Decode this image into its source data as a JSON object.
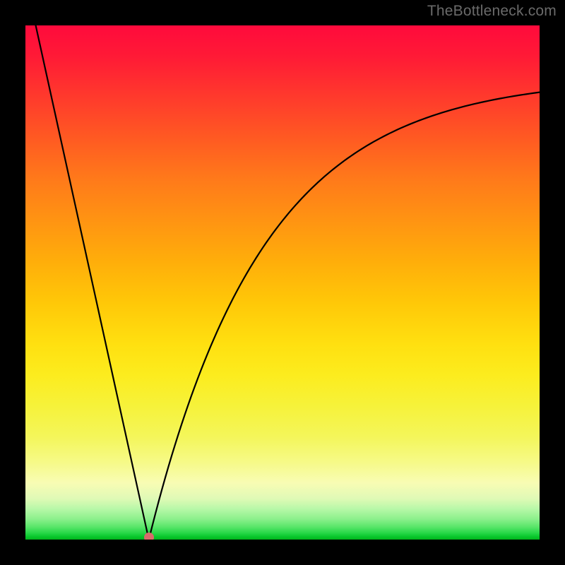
{
  "watermark": "TheBottleneck.com",
  "chart_data": {
    "type": "line",
    "title": "",
    "xlabel": "",
    "ylabel": "",
    "xlim": [
      0,
      100
    ],
    "ylim": [
      0,
      100
    ],
    "curve": {
      "left_start": {
        "x": 2,
        "y": 100
      },
      "min_point": {
        "x": 24,
        "y": 0
      },
      "right_end": {
        "x": 100,
        "y": 87
      },
      "right_shape_k": 0.045
    },
    "marker": {
      "x": 24,
      "y": 0.4,
      "color": "#d96b6b",
      "radius_px": 7
    },
    "gradient_stops": [
      {
        "pos": 0.0,
        "color": "#ff0a3c"
      },
      {
        "pos": 0.5,
        "color": "#ffc808"
      },
      {
        "pos": 0.8,
        "color": "#f4f65a"
      },
      {
        "pos": 1.0,
        "color": "#00b41c"
      }
    ]
  }
}
